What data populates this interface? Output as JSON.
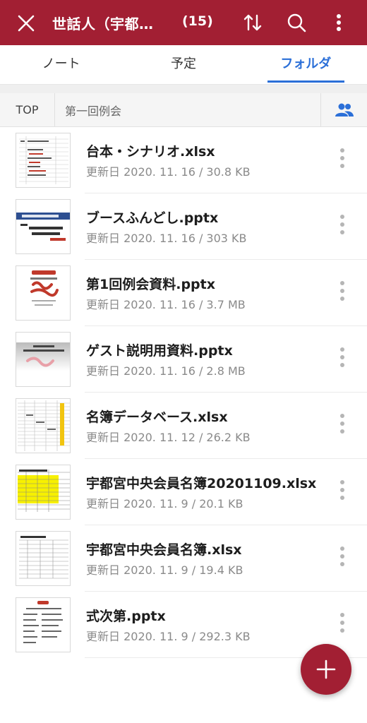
{
  "header": {
    "title": "世話人（宇都…",
    "count": "(15)",
    "icons": [
      "close-icon",
      "sort-icon",
      "search-icon",
      "more-vertical-icon"
    ]
  },
  "tabs": [
    {
      "label": "ノート",
      "active": false
    },
    {
      "label": "予定",
      "active": false
    },
    {
      "label": "フォルダ",
      "active": true
    }
  ],
  "breadcrumb": {
    "top": "TOP",
    "folder": "第一回例会"
  },
  "files": [
    {
      "name": "台本・シナリオ.xlsx",
      "meta": "更新日 2020. 11. 16 / 30.8 KB",
      "thumb": "sheet"
    },
    {
      "name": "ブースふんどし.pptx",
      "meta": "更新日 2020. 11. 16 / 303 KB",
      "thumb": "slide-blue"
    },
    {
      "name": "第1回例会資料.pptx",
      "meta": "更新日 2020. 11. 16 / 3.7 MB",
      "thumb": "slide-red"
    },
    {
      "name": "ゲスト説明用資料.pptx",
      "meta": "更新日 2020. 11. 16 / 2.8 MB",
      "thumb": "slide-gray"
    },
    {
      "name": "名簿データベース.xlsx",
      "meta": "更新日 2020. 11. 12 / 26.2 KB",
      "thumb": "sheet-dense"
    },
    {
      "name": "宇都宮中央会員名簿20201109.xlsx",
      "meta": "更新日 2020. 11. 9 / 20.1 KB",
      "thumb": "sheet-yellow"
    },
    {
      "name": "宇都宮中央会員名簿.xlsx",
      "meta": "更新日 2020. 11. 9 / 19.4 KB",
      "thumb": "sheet-grid"
    },
    {
      "name": "式次第.pptx",
      "meta": "更新日 2020. 11. 9 / 292.3 KB",
      "thumb": "doc"
    }
  ],
  "colors": {
    "brand": "#a21f33",
    "accent": "#2b6fd8"
  },
  "fab": {
    "icon": "plus-icon"
  }
}
